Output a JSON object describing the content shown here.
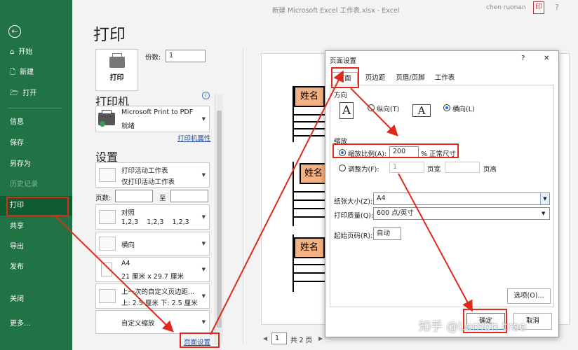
{
  "titlebar": {
    "title": "新建 Microsoft Excel 工作表.xlsx  -  Excel",
    "user": "chen ruonan",
    "avatar_text": "印"
  },
  "sidebar": {
    "items": [
      {
        "label": "开始",
        "icon": "home-icon"
      },
      {
        "label": "新建",
        "icon": "new-file-icon"
      },
      {
        "label": "打开",
        "icon": "open-folder-icon"
      },
      {
        "label": "信息"
      },
      {
        "label": "保存"
      },
      {
        "label": "另存为"
      },
      {
        "label": "历史记录"
      },
      {
        "label": "打印"
      },
      {
        "label": "共享"
      },
      {
        "label": "导出"
      },
      {
        "label": "发布"
      },
      {
        "label": "关闭"
      },
      {
        "label": "更多..."
      }
    ]
  },
  "print": {
    "heading": "打印",
    "print_button": "打印",
    "copies_label": "份数:",
    "copies_value": "1",
    "printer_heading": "打印机",
    "printer_name": "Microsoft Print to PDF",
    "printer_status": "就绪",
    "printer_props": "打印机属性",
    "settings_heading": "设置",
    "scope_main": "打印活动工作表",
    "scope_sub": "仅打印活动工作表",
    "pages_label": "页数:",
    "pages_to": "至",
    "collate_main": "对照",
    "collate_sub": "1,2,3    1,2,3    1,2,3",
    "orientation": "横向",
    "paper_main": "A4",
    "paper_sub": "21 厘米 x 29.7 厘米",
    "margin_main": "上一次的自定义页边距...",
    "margin_sub": "上: 2.5 厘米 下: 2.5 厘米",
    "scaling": "自定义缩放",
    "page_setup_link": "页面设置"
  },
  "preview": {
    "cell_text": "姓名",
    "page_current": "1",
    "page_total": "共 2 页"
  },
  "dialog": {
    "title": "页面设置",
    "help": "?",
    "close": "✕",
    "tabs": [
      "页面",
      "页边距",
      "页眉/页脚",
      "工作表"
    ],
    "orientation_group": "方向",
    "portrait": "纵向(T)",
    "landscape": "横向(L)",
    "scaling_group": "缩放",
    "scale_label": "缩放比例(A):",
    "scale_value": "200",
    "scale_suffix": "% 正常尺寸",
    "fit_label": "调整为(F):",
    "fit_wide_value": "1",
    "fit_wide_suffix": "页宽",
    "fit_tall_suffix": "页高",
    "paper_label": "纸张大小(Z):",
    "paper_value": "A4",
    "quality_label": "打印质量(Q):",
    "quality_value": "600 点/英寸",
    "first_page_label": "起始页码(R):",
    "first_page_value": "自动",
    "options_button": "选项(O)...",
    "ok_button": "确定",
    "cancel_button": "取消"
  },
  "watermark": "知乎 @Lemon tree",
  "colors": {
    "excel_green": "#217346",
    "annotation_red": "#e0281e",
    "cell_fill": "#f4b183"
  }
}
